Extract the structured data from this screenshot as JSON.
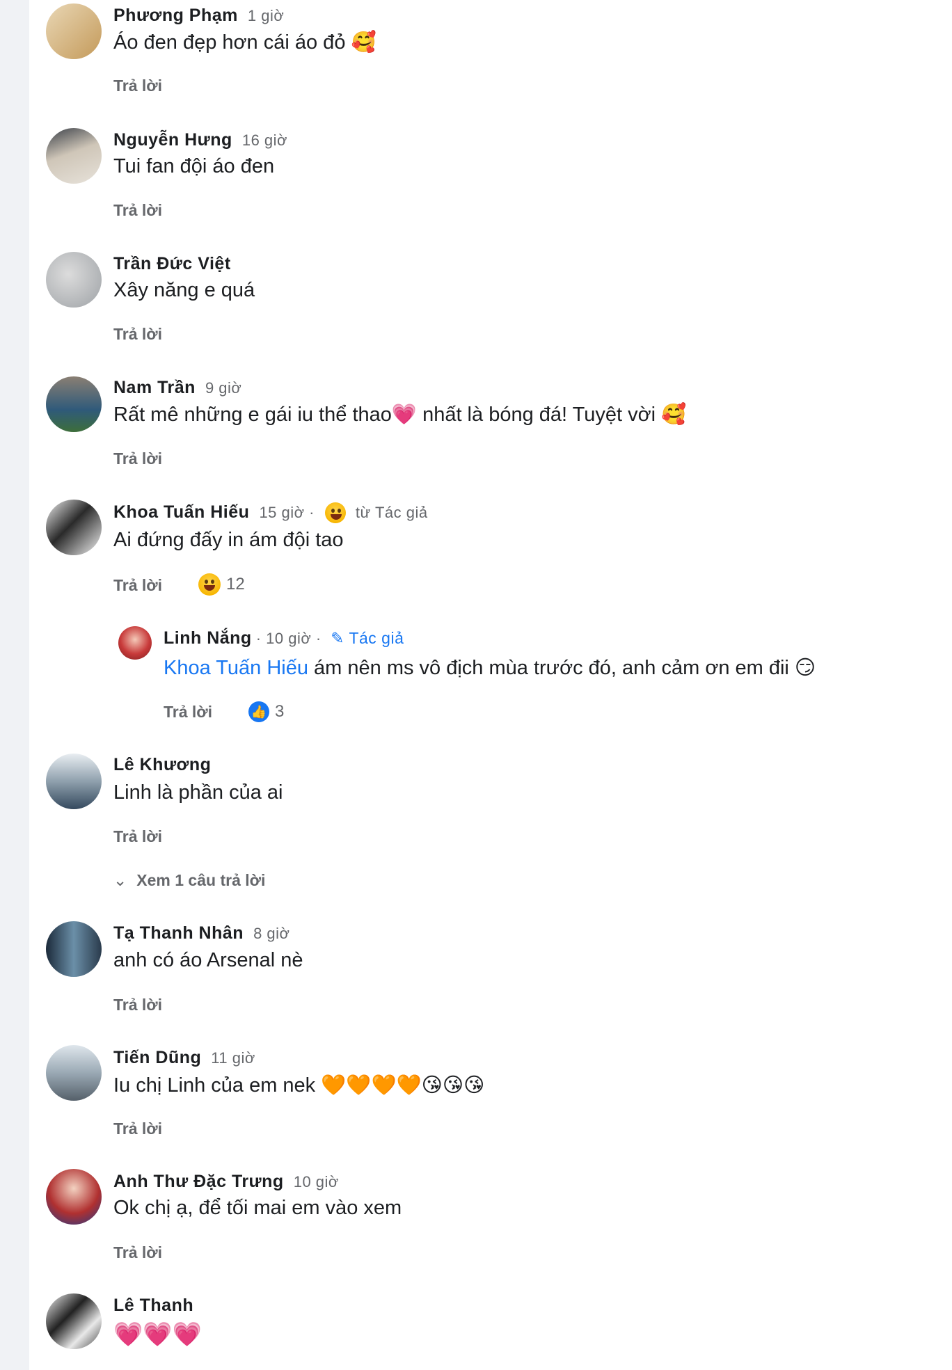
{
  "reply_label": "Trả lời",
  "comments": [
    {
      "author": "Phương Phạm",
      "meta": "1 giờ",
      "text": "Áo đen đẹp hơn cái áo đỏ 🥰"
    },
    {
      "author": "Nguyễn Hưng",
      "meta": "16 giờ",
      "text": "Tui fan đội áo đen"
    },
    {
      "author": "Trần Đức Việt",
      "meta": "",
      "text": "Xây năng e quá"
    },
    {
      "author": "Nam Trần",
      "meta": "9 giờ",
      "text": "Rất mê những e gái iu thể thao💗 nhất là bóng đá! Tuyệt vời 🥰"
    },
    {
      "author": "Khoa Tuấn Hiếu",
      "meta": "15 giờ ·",
      "author_react": "từ Tác giả",
      "text": "Ai đứng đấy in ám đội tao",
      "react_count": "12"
    },
    {
      "author": "Linh Nắng",
      "meta": "· 10 giờ ·",
      "author_badge": "Tác giả",
      "mention": "Khoa Tuấn Hiếu",
      "text": "ám nên ms vô địch mùa trước đó, anh cảm ơn em đii 😏",
      "react_count": "3"
    },
    {
      "author": "Lê Khương",
      "meta": "",
      "text": "Linh là phần của ai",
      "view_more": "Xem 1 câu trả lời"
    },
    {
      "author": "Tạ Thanh Nhân",
      "meta": "8 giờ",
      "text": "anh có áo Arsenal nè"
    },
    {
      "author": "Tiến Dũng",
      "meta": "11 giờ",
      "text": "Iu chị Linh của em nek 🧡🧡🧡🧡😘😘😘"
    },
    {
      "author": "Anh Thư Đặc Trưng",
      "meta": "10 giờ",
      "text": "Ok chị ạ, để tối mai em vào xem"
    },
    {
      "author": "Lê Thanh",
      "meta": "",
      "text": "💗💗💗"
    }
  ]
}
